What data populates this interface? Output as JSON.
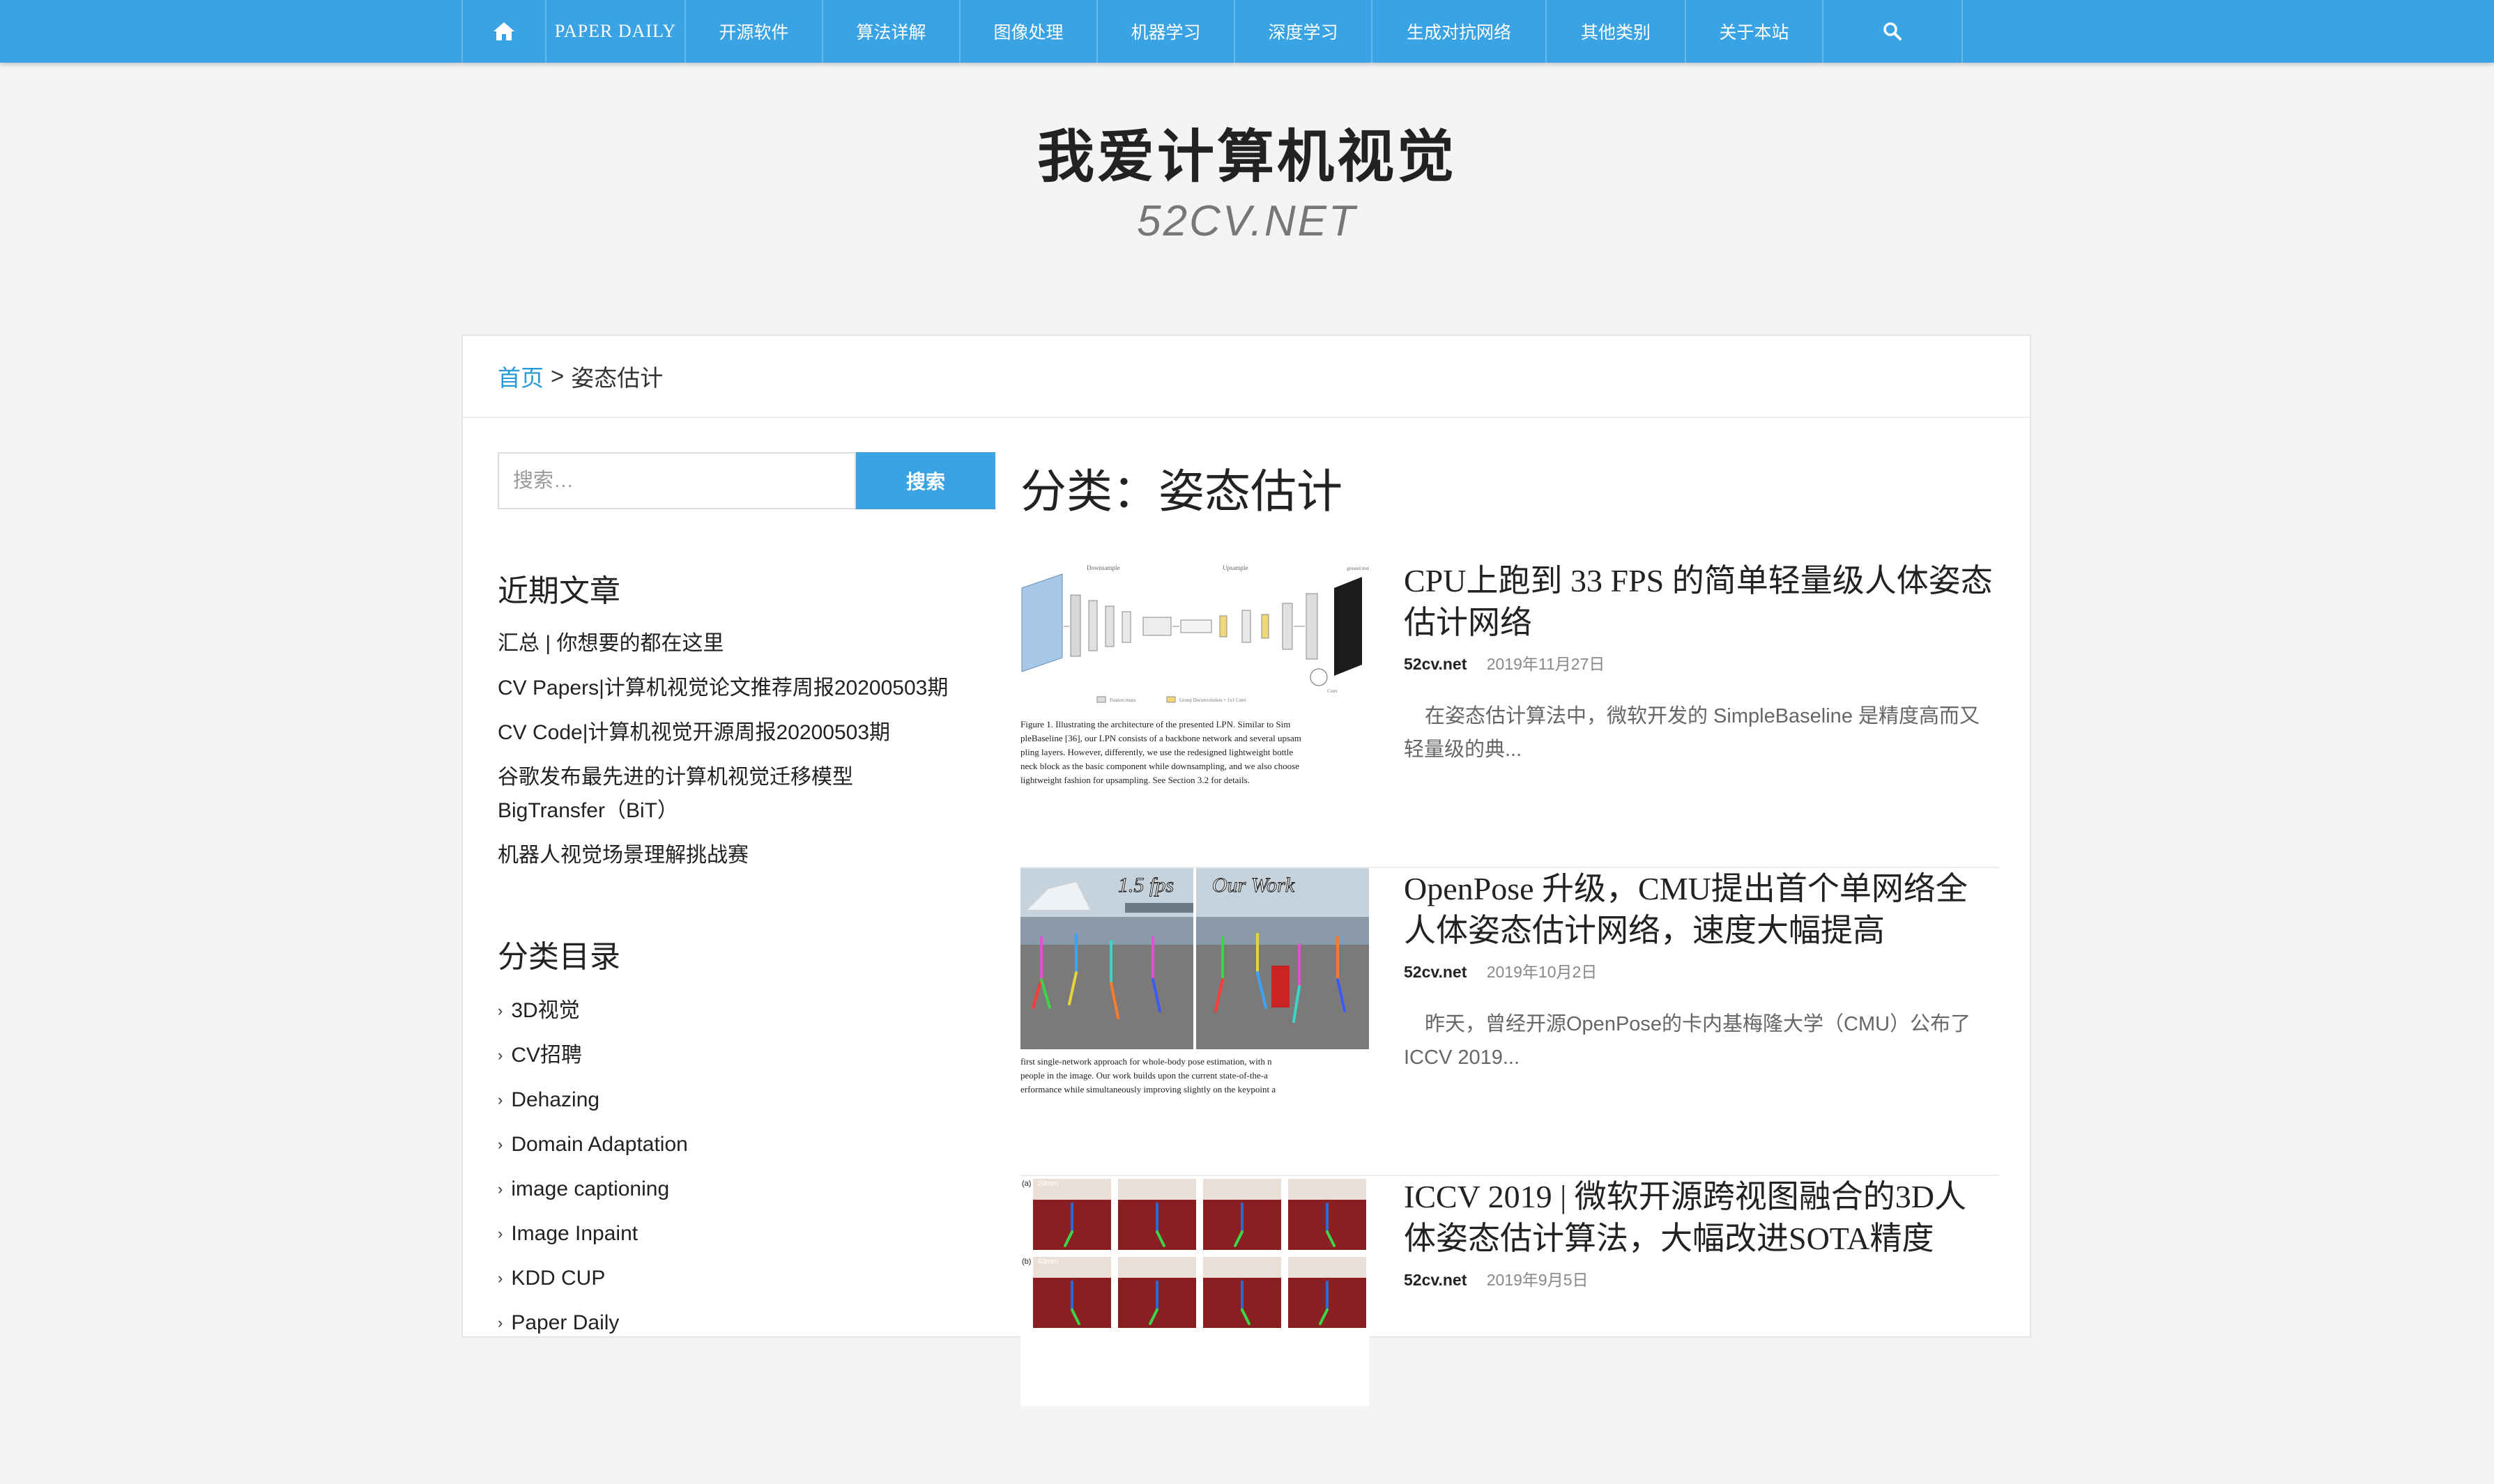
{
  "nav": {
    "items": [
      "PAPER DAILY",
      "开源软件",
      "算法详解",
      "图像处理",
      "机器学习",
      "深度学习",
      "生成对抗网络",
      "其他类别",
      "关于本站"
    ]
  },
  "site": {
    "title": "我爱计算机视觉",
    "subtitle": "52CV.NET"
  },
  "breadcrumb": {
    "home": "首页",
    "separator": ">",
    "current": "姿态估计"
  },
  "search": {
    "placeholder": "搜索…",
    "button": "搜索"
  },
  "recent": {
    "title": "近期文章",
    "items": [
      "汇总 | 你想要的都在这里",
      "CV Papers|计算机视觉论文推荐周报20200503期",
      "CV Code|计算机视觉开源周报20200503期",
      "谷歌发布最先进的计算机视觉迁移模型BigTransfer（BiT）",
      "机器人视觉场景理解挑战赛"
    ]
  },
  "categories": {
    "title": "分类目录",
    "items": [
      "3D视觉",
      "CV招聘",
      "Dehazing",
      "Domain Adaptation",
      "image captioning",
      "Image Inpaint",
      "KDD CUP",
      "Paper Daily"
    ]
  },
  "main": {
    "heading": "分类：姿态估计",
    "posts": [
      {
        "title": "CPU上跑到 33 FPS 的简单轻量级人体姿态估计网络",
        "author": "52cv.net",
        "date": "2019年11月27日",
        "excerpt": "在姿态估计算法中，微软开发的 SimpleBaseline 是精度高而又轻量级的典...",
        "thumb_caption": [
          "Figure 1.   Illustrating the architecture of the presented LPN. Similar to Sim",
          "pleBaseline [36], our LPN consists of a backbone network and several upsam",
          "pling layers. However, differently, we use the redesigned lightweight bottle",
          "neck block as the basic component while downsampling, and we also choose",
          "lightweight fashion for upsampling. See Section 3.2 for details."
        ],
        "thumb_labels": [
          "Downsample",
          "Upsample",
          "ground truth heatmaps",
          "Feature maps",
          "Group Deconvolution + 1x1 Conv",
          "Conv"
        ]
      },
      {
        "title": "OpenPose 升级，CMU提出首个单网络全人体姿态估计网络，速度大幅提高",
        "author": "52cv.net",
        "date": "2019年10月2日",
        "excerpt": "昨天，曾经开源OpenPose的卡内基梅隆大学（CMU）公布了ICCV 2019...",
        "thumb_caption": [
          "first single-network approach for whole-body pose estimation, with n",
          "people in the image. Our work builds upon the current state-of-the-a",
          "erformance while simultaneously improving slightly on the keypoint a"
        ],
        "thumb_labels": [
          "1.5 fps",
          "Our Work"
        ]
      },
      {
        "title": "ICCV 2019 | 微软开源跨视图融合的3D人体姿态估计算法，大幅改进SOTA精度",
        "author": "52cv.net",
        "date": "2019年9月5日",
        "excerpt": "",
        "thumb_caption": [],
        "thumb_labels": [
          "(a)",
          "20mm",
          "(b)",
          "40mm"
        ]
      }
    ]
  },
  "colors": {
    "accent": "#3aa3e3",
    "link": "#2a9ad9"
  },
  "icons": {
    "home": "home-icon",
    "search": "search-icon",
    "chevron": "chevron-right-icon"
  }
}
